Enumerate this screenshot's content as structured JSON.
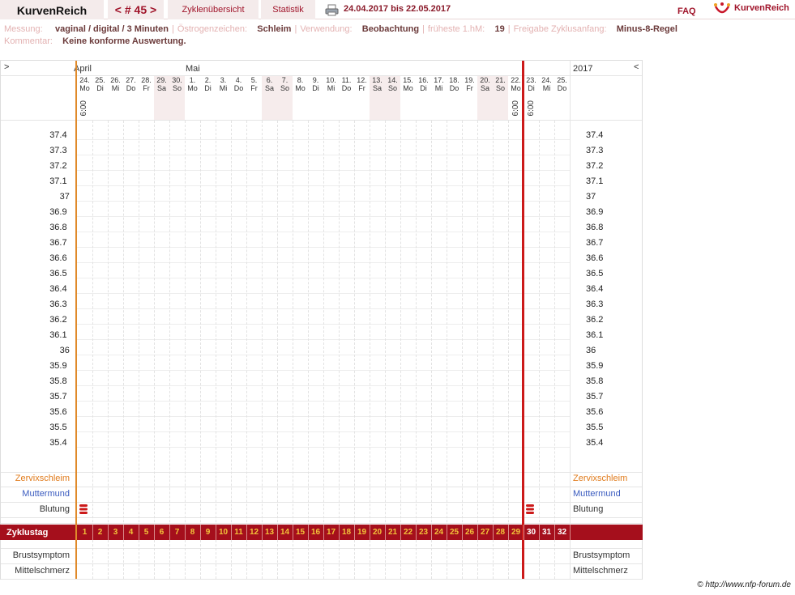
{
  "header": {
    "app_title": "KurvenReich",
    "cycle_nav": "< # 45 >",
    "tab_overview": "Zyklenübersicht",
    "tab_stats": "Statistik",
    "date_range": "24.04.2017 bis 22.05.2017",
    "faq": "FAQ",
    "logo_text": "KurvenReich"
  },
  "info": {
    "messung_label": "Messung:",
    "messung_value": "vaginal / digital / 3 Minuten",
    "oestrogen_label": "Östrogenzeichen:",
    "oestrogen_value": "Schleim",
    "verwendung_label": "Verwendung:",
    "verwendung_value": "Beobachtung",
    "fruheste_label": "früheste 1.hM:",
    "fruheste_value": "19",
    "freigabe_label": "Freigabe Zyklusanfang:",
    "freigabe_value": "Minus-8-Regel",
    "kommentar_label": "Kommentar:",
    "kommentar_value": "Keine konforme Auswertung."
  },
  "chart": {
    "nav_left": ">",
    "nav_right": "<",
    "month_april": "April",
    "month_mai": "Mai",
    "year": "2017",
    "day_numbers": [
      "24.",
      "25.",
      "26.",
      "27.",
      "28.",
      "29.",
      "30.",
      "1.",
      "2.",
      "3.",
      "4.",
      "5.",
      "6.",
      "7.",
      "8.",
      "9.",
      "10.",
      "11.",
      "12.",
      "13.",
      "14.",
      "15.",
      "16.",
      "17.",
      "18.",
      "19.",
      "20.",
      "21.",
      "22.",
      "23.",
      "24.",
      "25."
    ],
    "day_names": [
      "Mo",
      "Di",
      "Mi",
      "Do",
      "Fr",
      "Sa",
      "So",
      "Mo",
      "Di",
      "Mi",
      "Do",
      "Fr",
      "Sa",
      "So",
      "Mo",
      "Di",
      "Mi",
      "Do",
      "Fr",
      "Sa",
      "So",
      "Mo",
      "Di",
      "Mi",
      "Do",
      "Fr",
      "Sa",
      "So",
      "Mo",
      "Di",
      "Mi",
      "Do"
    ],
    "weekend_indices": [
      5,
      6,
      12,
      13,
      19,
      20,
      26,
      27
    ],
    "time_label_1": "6:00",
    "time_label_2": "6:00",
    "temperatures": [
      "37.4",
      "37.3",
      "37.2",
      "37.1",
      "37",
      "36.9",
      "36.8",
      "36.7",
      "36.6",
      "36.5",
      "36.4",
      "36.3",
      "36.2",
      "36.1",
      "36",
      "35.9",
      "35.8",
      "35.7",
      "35.6",
      "35.5",
      "35.4"
    ],
    "row_zervix": "Zervixschleim",
    "row_muttermund": "Muttermund",
    "row_blutung": "Blutung",
    "row_zyklustag": "Zyklustag",
    "row_brust": "Brustsymptom",
    "row_mittel": "Mittelschmerz",
    "cycle_days": [
      "1",
      "2",
      "3",
      "4",
      "5",
      "6",
      "7",
      "8",
      "9",
      "10",
      "11",
      "12",
      "13",
      "14",
      "15",
      "16",
      "17",
      "18",
      "19",
      "20",
      "21",
      "22",
      "23",
      "24",
      "25",
      "26",
      "27",
      "28",
      "29",
      "30",
      "31",
      "32"
    ],
    "colors": {
      "zervix": "#e07a1a",
      "muttermund": "#3a5bbf",
      "accent": "#a50f1c",
      "cycle_start_line": "#e08a2a",
      "cycle_end_line": "#cc1a1a"
    }
  },
  "footer": {
    "copyright": "© http://www.nfp-forum.de"
  }
}
